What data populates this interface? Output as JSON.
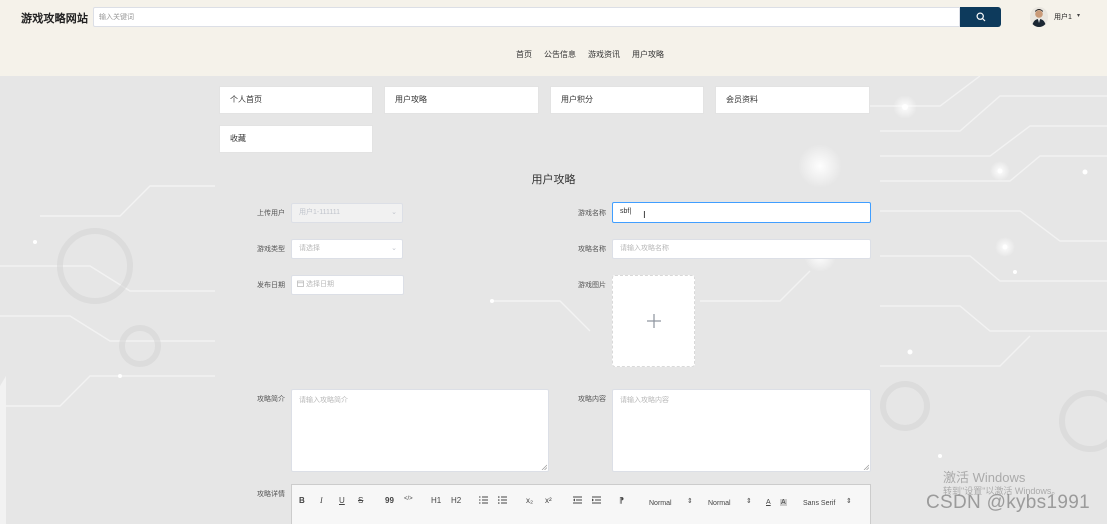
{
  "header": {
    "site_title": "游戏攻略网站",
    "search_placeholder": "输入关键词",
    "user_name": "用户1",
    "user_caret": "▾"
  },
  "nav": {
    "items": [
      "首页",
      "公告信息",
      "游戏资讯",
      "用户攻略"
    ]
  },
  "tabs": [
    "个人首页",
    "用户攻略",
    "用户积分",
    "会员资料",
    "收藏"
  ],
  "form": {
    "title": "用户攻略",
    "upload_user_label": "上传用户",
    "upload_user_value": "用户1-111111",
    "game_name_label": "游戏名称",
    "game_name_value": "sbf",
    "game_type_label": "游戏类型",
    "game_type_placeholder": "请选择",
    "guide_name_label": "攻略名称",
    "guide_name_placeholder": "请输入攻略名称",
    "publish_date_label": "发布日期",
    "publish_date_placeholder": "选择日期",
    "game_image_label": "游戏图片",
    "intro_label": "攻略简介",
    "intro_placeholder": "请输入攻略简介",
    "content_label": "攻略内容",
    "content_placeholder": "请输入攻略内容",
    "detail_label": "攻略详情"
  },
  "editor": {
    "bold": "B",
    "italic": "I",
    "underline": "U",
    "strike": "S",
    "quote": "99",
    "code": "</>",
    "h1": "H1",
    "h2": "H2",
    "sub": "x₂",
    "sup": "x²",
    "header_select": "Normal",
    "size_select": "Normal",
    "font_select": "Sans Serif",
    "text_color": "A"
  },
  "watermarks": {
    "windows_title": "激活 Windows",
    "windows_sub": "转到\"设置\"以激活 Windows。",
    "csdn": "CSDN @kybs1991"
  },
  "colors": {
    "accent": "#0d3a5c",
    "focus": "#409eff",
    "header_bg": "#f5f2ea",
    "main_bg": "#e7e7e7"
  }
}
